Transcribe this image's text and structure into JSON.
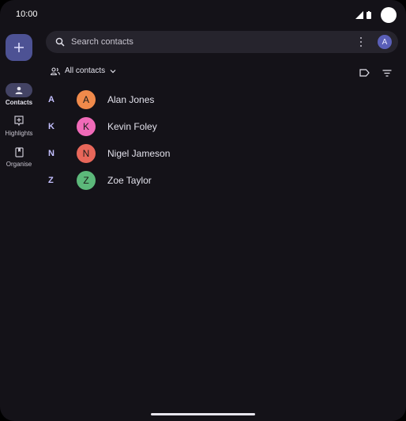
{
  "status_bar": {
    "time": "10:00"
  },
  "nav_rail": {
    "fab_icon": "plus-icon",
    "items": [
      {
        "label": "Contacts",
        "icon": "person-icon",
        "active": true
      },
      {
        "label": "Highlights",
        "icon": "highlights-icon",
        "active": false
      },
      {
        "label": "Organise",
        "icon": "organise-icon",
        "active": false
      }
    ]
  },
  "search": {
    "placeholder": "Search contacts",
    "account_initial": "A"
  },
  "toolbar": {
    "filter_label": "All contacts"
  },
  "contacts": [
    {
      "letter": "A",
      "initial": "A",
      "name": "Alan Jones",
      "color": "#f08a4b"
    },
    {
      "letter": "K",
      "initial": "K",
      "name": "Kevin Foley",
      "color": "#f06ab8"
    },
    {
      "letter": "N",
      "initial": "N",
      "name": "Nigel Jameson",
      "color": "#e8675a"
    },
    {
      "letter": "Z",
      "initial": "Z",
      "name": "Zoe Taylor",
      "color": "#5cb87a"
    }
  ],
  "colors": {
    "background": "#141218",
    "accent": "#4d5294",
    "section_letter": "#c4c0ff"
  }
}
